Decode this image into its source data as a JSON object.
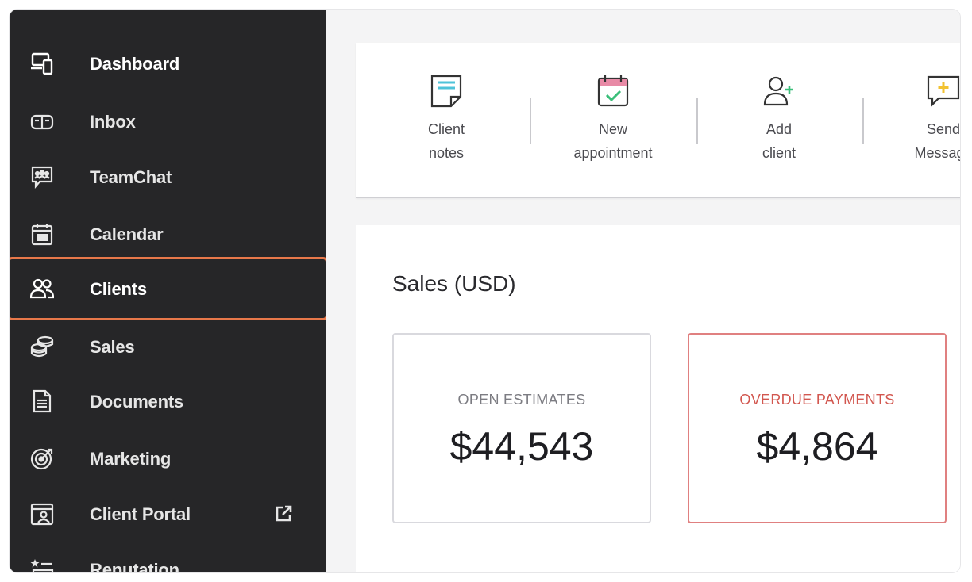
{
  "sidebar": {
    "items": [
      {
        "label": "Dashboard",
        "icon": "devices-icon"
      },
      {
        "label": "Inbox",
        "icon": "inbox-icon"
      },
      {
        "label": "TeamChat",
        "icon": "team-chat-icon"
      },
      {
        "label": "Calendar",
        "icon": "calendar-icon"
      },
      {
        "label": "Clients",
        "icon": "clients-icon",
        "active": true
      },
      {
        "label": "Sales",
        "icon": "coins-icon"
      },
      {
        "label": "Documents",
        "icon": "document-icon"
      },
      {
        "label": "Marketing",
        "icon": "target-icon"
      },
      {
        "label": "Client Portal",
        "icon": "portal-icon",
        "external": "external-link-icon"
      },
      {
        "label": "Reputation",
        "icon": "reputation-icon"
      }
    ],
    "active_outline_color": "#e8784a"
  },
  "quick_actions": [
    {
      "label": "Client\nnotes",
      "icon": "client-notes-icon"
    },
    {
      "label": "New\nappointment",
      "icon": "new-appointment-icon"
    },
    {
      "label": "Add\nclient",
      "icon": "add-client-icon"
    },
    {
      "label": "Send\nMessage",
      "icon": "send-message-icon"
    }
  ],
  "sales": {
    "title": "Sales (USD)",
    "open_estimates": {
      "label": "OPEN ESTIMATES",
      "value": "$44,543"
    },
    "overdue_payments": {
      "label": "OVERDUE PAYMENTS",
      "value": "$4,864",
      "accent": "#d2574f"
    }
  },
  "colors": {
    "sidebar_bg": "#262628",
    "accent_teal": "#4fc3d9",
    "accent_pink": "#e88aa6",
    "accent_green": "#3bbf7a",
    "accent_yellow": "#f2c230"
  }
}
